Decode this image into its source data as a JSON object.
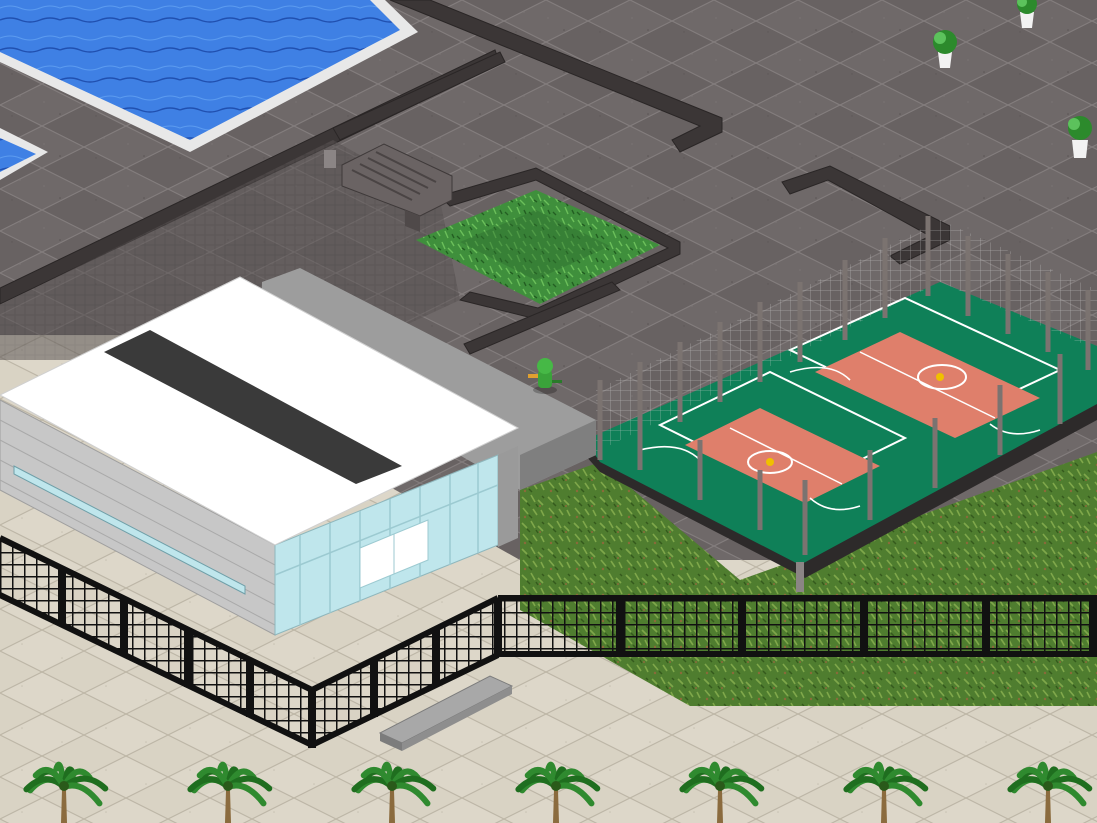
{
  "game": {
    "view": "isometric",
    "colors": {
      "plaza_tile": "#6b6464",
      "plaza_tile_dark": "#5d5757",
      "plaza_grout": "#8a8585",
      "sidewalk_tile": "#dcd6c8",
      "sidewalk_grout": "#b9b2a3",
      "pool_water": "#3e7de0",
      "pool_rim": "#e6e6e6",
      "wall": "#3a3535",
      "wall_top": "#4d4747",
      "grass": "#3c8a3c",
      "grass_dark": "#2c6a2c",
      "lawn": "#4a7a2e",
      "court_green": "#138a60",
      "court_clay": "#dd7f6a",
      "court_line": "#ffffff",
      "building_roof": "#ffffff",
      "roof_stripe": "#3a3a3a",
      "building_wall": "#cfcfcf",
      "glass": "#bfe6ec",
      "fence_black": "#111111",
      "fence_post": "#7c7470",
      "bench": "#8a8a8a",
      "palm": "#2f8a2f",
      "palm_trunk": "#8b6b3e",
      "avatar": "#3aa33a"
    },
    "objects": [
      {
        "kind": "pool",
        "name": "swimming-pool"
      },
      {
        "kind": "planter",
        "name": "garden-planter"
      },
      {
        "kind": "building",
        "name": "sports-hall"
      },
      {
        "kind": "court",
        "name": "basketball-court-left"
      },
      {
        "kind": "court",
        "name": "basketball-court-right"
      },
      {
        "kind": "fence",
        "name": "perimeter-fence"
      },
      {
        "kind": "bench",
        "name": "stone-bench"
      },
      {
        "kind": "avatar",
        "name": "player-avatar"
      },
      {
        "kind": "potted-plant",
        "name": "potted-plant"
      },
      {
        "kind": "palm",
        "name": "palm-tree"
      }
    ]
  }
}
